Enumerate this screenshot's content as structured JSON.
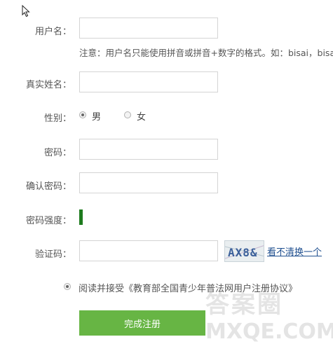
{
  "form": {
    "username": {
      "label": "用户名：",
      "value": ""
    },
    "username_hint": "注意：用户名只能使用拼音或拼音+数字的格式。如：bisai，bisa",
    "real_name": {
      "label": "真实姓名：",
      "value": ""
    },
    "gender": {
      "label": "性别：",
      "options": [
        "男",
        "女"
      ],
      "selected": "男"
    },
    "password": {
      "label": "密码：",
      "value": ""
    },
    "confirm_password": {
      "label": "确认密码：",
      "value": ""
    },
    "strength": {
      "label": "密码强度："
    },
    "captcha": {
      "label": "验证码：",
      "value": "",
      "image_text": "AX8&",
      "refresh_link": "看不清换一个"
    },
    "agreement": {
      "text": "阅读并接受《教育部全国青少年普法网用户注册协议》",
      "checked": true
    },
    "submit_label": "完成注册"
  },
  "watermark": {
    "line1": "答案圈",
    "line2": "MXQE.COM"
  },
  "colors": {
    "submit_bg": "#67b544",
    "strength": "#1e7b1e",
    "link": "#1f4f8f"
  }
}
